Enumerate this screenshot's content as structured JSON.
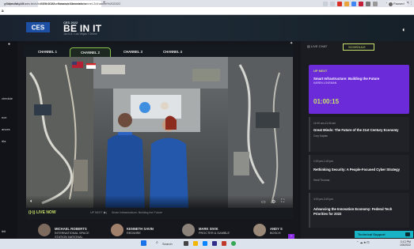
{
  "browser": {
    "tabs": [
      {
        "label": "gCalendar - O",
        "close": "×"
      },
      {
        "label": "CES 2022 - Session Channels",
        "close": "×"
      }
    ],
    "new_tab": "+",
    "window_controls": [
      "–",
      "□",
      "✕"
    ],
    "url": "https://digital.ces.tech/bi/schedule/sessions/channels/channel-2/channel%202022",
    "profile": "Paused"
  },
  "header": {
    "logo": "CES",
    "edition": "CES 2022",
    "title": "BE IN IT",
    "subtitle": "Jan 5-8 / Las Vegas / Online"
  },
  "left_strip": {
    "labels": [
      "chedule",
      "nce",
      "ances",
      "dia",
      "ibit"
    ]
  },
  "channels": {
    "tabs": [
      "CHANNEL 1",
      "CHANNEL 2",
      "CHANNEL 3",
      "CHANNEL 4"
    ],
    "active_index": 1
  },
  "video": {
    "live_label": "LIVE NOW",
    "up_next_label": "UP NEXT",
    "up_next_title": "Smart Infrastructure: Building the Future"
  },
  "speakers": [
    {
      "name": "MICHAEL ROBERTS",
      "org": "INTERNATIONAL SPACE",
      "org2": "STATION NATIONAL"
    },
    {
      "name": "KENNETH SAVIN",
      "org": "REDWIRE",
      "org2": ""
    },
    {
      "name": "MARK SIVIK",
      "org": "PROCTER & GAMBLE",
      "org2": ""
    },
    {
      "name": "ANDY S",
      "org": "BOSCH",
      "org2": ""
    }
  ],
  "right_panel": {
    "live_chat": "LIVE CHAT",
    "schedule": "SCHEDULE",
    "up_next": {
      "label": "UP NEXT",
      "title": "Smart Infrastructure: Building the Future",
      "speaker": "KAREN LOVEMAN",
      "timer": "01:00:15"
    },
    "sessions": [
      {
        "time": "11:00 am-11:40 am",
        "title": "Great Minds: The Future of the 21st Century Economy",
        "speaker": "Cory Kaplan"
      },
      {
        "time": "1:00 pm-1:40 pm",
        "title": "Rethinking Security: A People-Focused Cyber Strategy",
        "speaker": "Heidi Thomas"
      },
      {
        "time": "3:00 pm-3:40 pm",
        "title": "Advancing the Innovation Economy: Federal Tech Priorities for 2022",
        "speaker": ""
      }
    ],
    "support": "Technical Support"
  },
  "taskbar": {
    "search": "Search",
    "time": "3:13 PM",
    "date": "1/5/2022"
  },
  "colors": {
    "accent_green": "#c6e26a",
    "up_next_purple": "#6c2bd9",
    "support_teal": "#18b4c6"
  }
}
